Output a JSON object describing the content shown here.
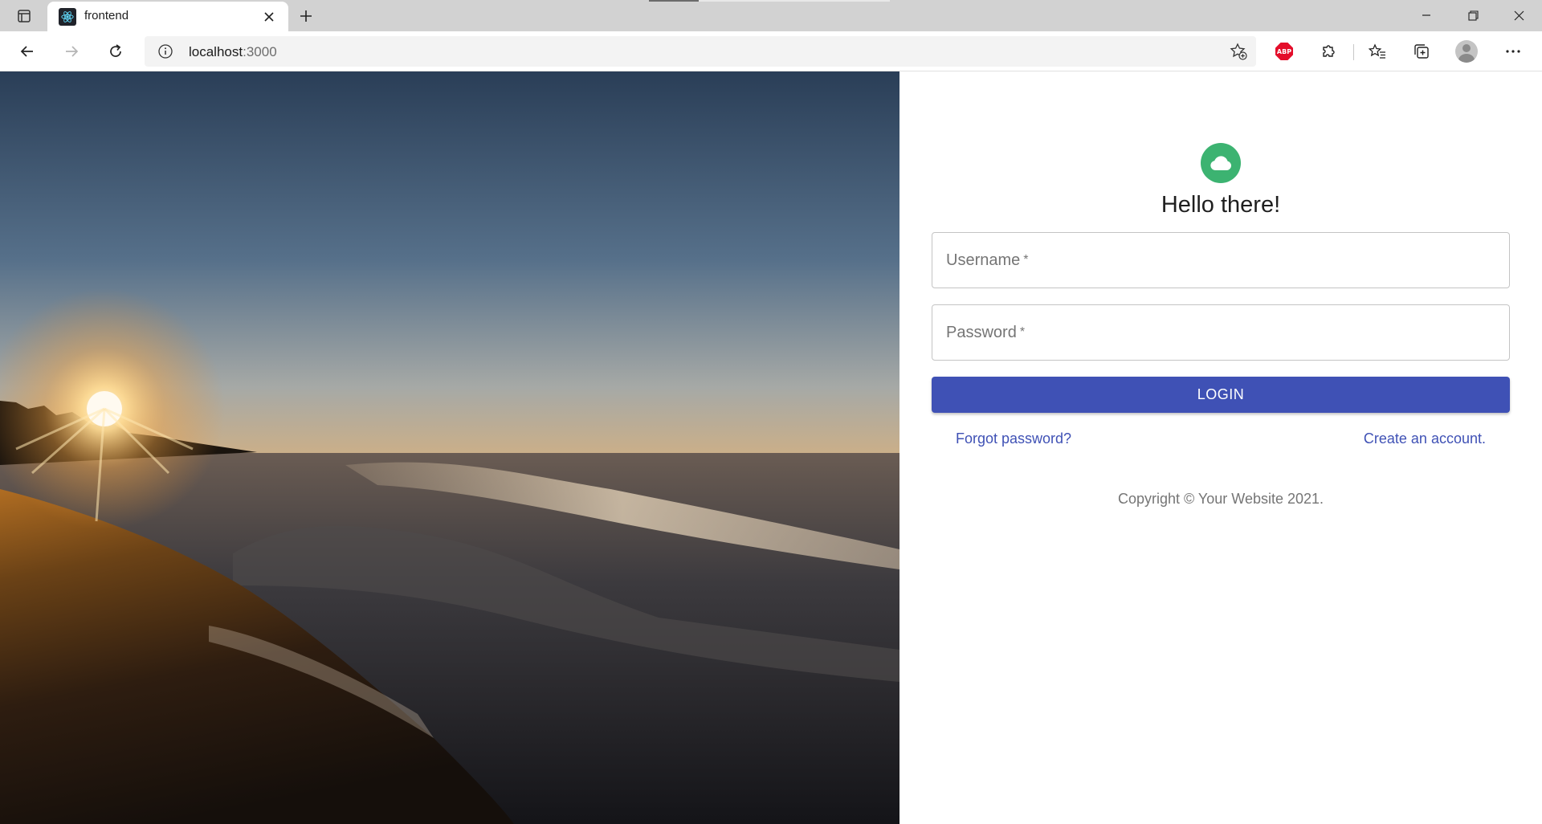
{
  "browser": {
    "tab": {
      "title": "frontend",
      "favicon": "react-logo-icon"
    },
    "address": {
      "host": "localhost",
      "port": ":3000"
    },
    "window_controls": [
      "minimize-icon",
      "restore-icon",
      "close-icon"
    ],
    "toolbar_icons": [
      "back-arrow-icon",
      "forward-arrow-icon",
      "refresh-icon",
      "info-icon",
      "add-favorite-icon",
      "adblock-icon",
      "extensions-icon",
      "favorites-icon",
      "collections-icon",
      "profile-icon",
      "more-icon"
    ],
    "adblock_label": "ABP"
  },
  "page": {
    "heading": "Hello there!",
    "logo_icon": "cloud-icon",
    "username_label": "Username",
    "password_label": "Password",
    "required_mark": "*",
    "login_label": "LOGIN",
    "forgot_link": "Forgot password?",
    "signup_link": "Create an account.",
    "copyright": "Copyright © Your Website 2021."
  },
  "colors": {
    "primary": "#3f51b5",
    "logo_bg": "#3cb371",
    "field_border": "#c4c4c4"
  }
}
